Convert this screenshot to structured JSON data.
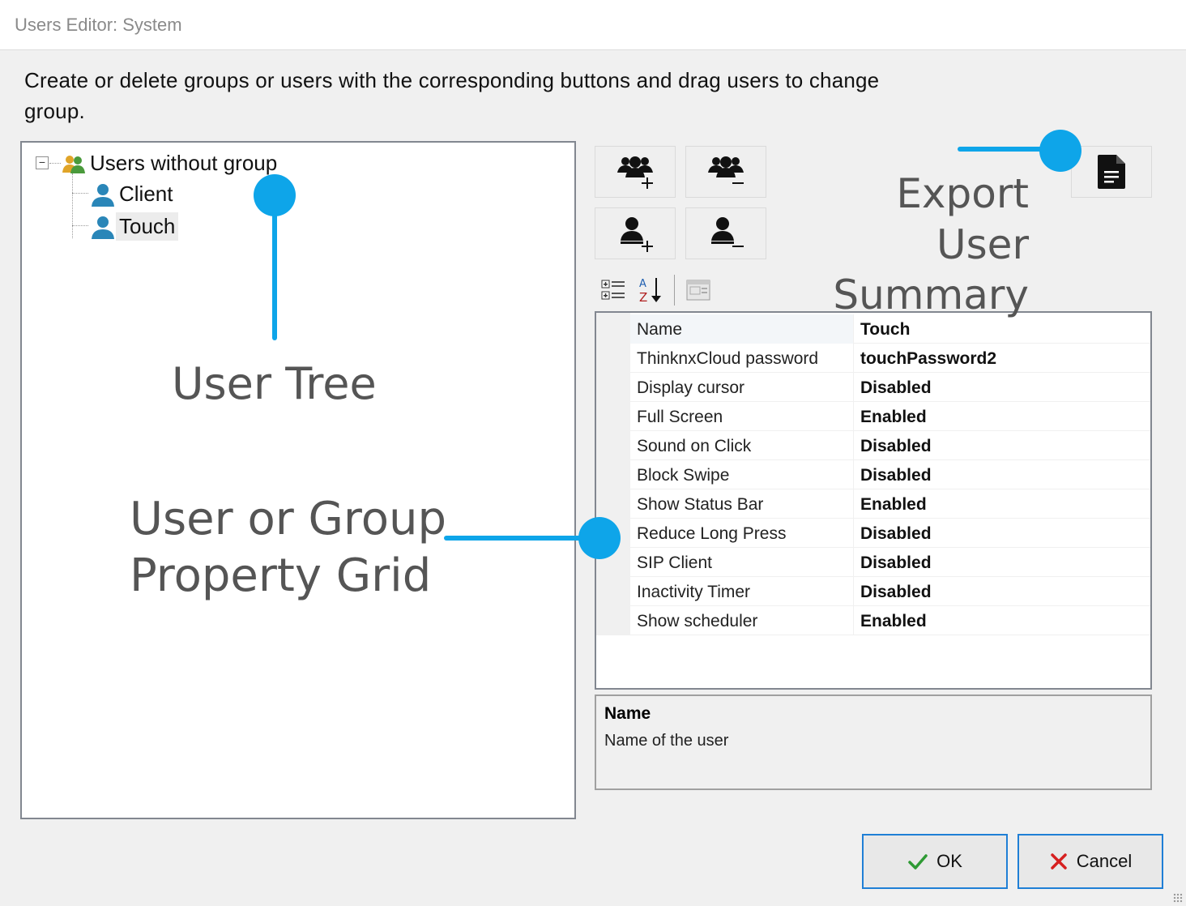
{
  "window": {
    "title": "Users Editor: System"
  },
  "instructions": "Create or delete groups or users with the corresponding buttons and drag users to change group.",
  "tree": {
    "root_label": "Users without group",
    "items": [
      {
        "label": "Client",
        "icon": "user-icon",
        "selected": false
      },
      {
        "label": "Touch",
        "icon": "user-icon",
        "selected": true
      }
    ]
  },
  "toolbar": {
    "buttons": [
      "add-group-icon",
      "remove-group-icon",
      "add-user-icon",
      "remove-user-icon",
      "export-document-icon"
    ]
  },
  "sort_bar": {
    "icons": [
      "categorized-icon",
      "alphabetical-sort-icon",
      "property-pages-icon"
    ]
  },
  "property_grid": {
    "rows": [
      {
        "name": "Name",
        "value": "Touch"
      },
      {
        "name": "ThinknxCloud password",
        "value": "touchPassword2"
      },
      {
        "name": "Display cursor",
        "value": "Disabled"
      },
      {
        "name": "Full Screen",
        "value": "Enabled"
      },
      {
        "name": "Sound on Click",
        "value": "Disabled"
      },
      {
        "name": "Block Swipe",
        "value": "Disabled"
      },
      {
        "name": "Show Status Bar",
        "value": "Enabled"
      },
      {
        "name": "Reduce Long Press",
        "value": "Disabled"
      },
      {
        "name": "SIP Client",
        "value": "Disabled"
      },
      {
        "name": "Inactivity Timer",
        "value": "Disabled"
      },
      {
        "name": "Show scheduler",
        "value": "Enabled"
      }
    ],
    "help": {
      "title": "Name",
      "description": "Name of the user"
    }
  },
  "buttons": {
    "ok": "OK",
    "cancel": "Cancel"
  },
  "annotations": {
    "user_tree": "User Tree",
    "property_grid_line1": "User or Group",
    "property_grid_line2": "Property Grid",
    "export_line1": "Export User",
    "export_line2": "Summary",
    "accent": "#0ea5e9"
  }
}
